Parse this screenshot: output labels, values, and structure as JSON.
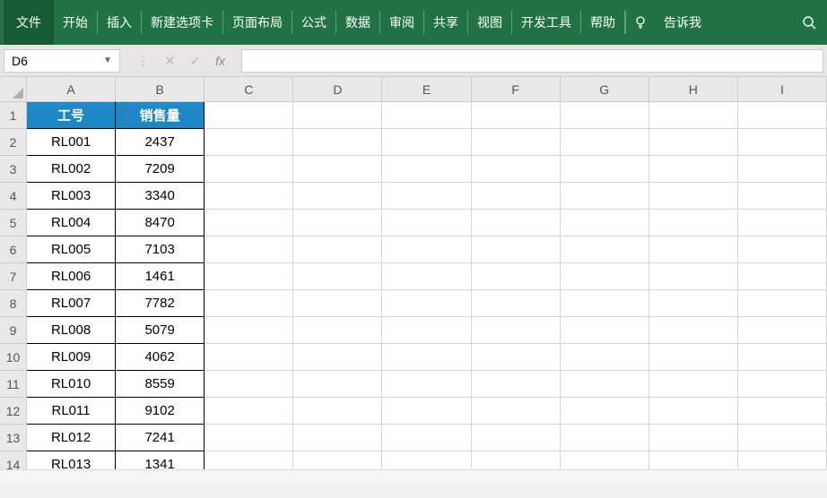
{
  "ribbon": {
    "file": "文件",
    "tabs": [
      "开始",
      "插入",
      "新建选项卡",
      "页面布局",
      "公式",
      "数据",
      "审阅",
      "共享",
      "视图",
      "开发工具",
      "帮助"
    ],
    "tellme": "告诉我"
  },
  "formula_bar": {
    "name_box": "D6",
    "fx": "fx"
  },
  "columns": [
    "A",
    "B",
    "C",
    "D",
    "E",
    "F",
    "G",
    "H",
    "I"
  ],
  "rows": [
    "1",
    "2",
    "3",
    "4",
    "5",
    "6",
    "7",
    "8",
    "9",
    "10",
    "11",
    "12",
    "13",
    "14"
  ],
  "table": {
    "header": {
      "col_a": "工号",
      "col_b": "销售量"
    },
    "data": [
      {
        "a": "RL001",
        "b": "2437"
      },
      {
        "a": "RL002",
        "b": "7209"
      },
      {
        "a": "RL003",
        "b": "3340"
      },
      {
        "a": "RL004",
        "b": "8470"
      },
      {
        "a": "RL005",
        "b": "7103"
      },
      {
        "a": "RL006",
        "b": "1461"
      },
      {
        "a": "RL007",
        "b": "7782"
      },
      {
        "a": "RL008",
        "b": "5079"
      },
      {
        "a": "RL009",
        "b": "4062"
      },
      {
        "a": "RL010",
        "b": "8559"
      },
      {
        "a": "RL011",
        "b": "9102"
      },
      {
        "a": "RL012",
        "b": "7241"
      },
      {
        "a": "RL013",
        "b": "1341"
      }
    ]
  }
}
